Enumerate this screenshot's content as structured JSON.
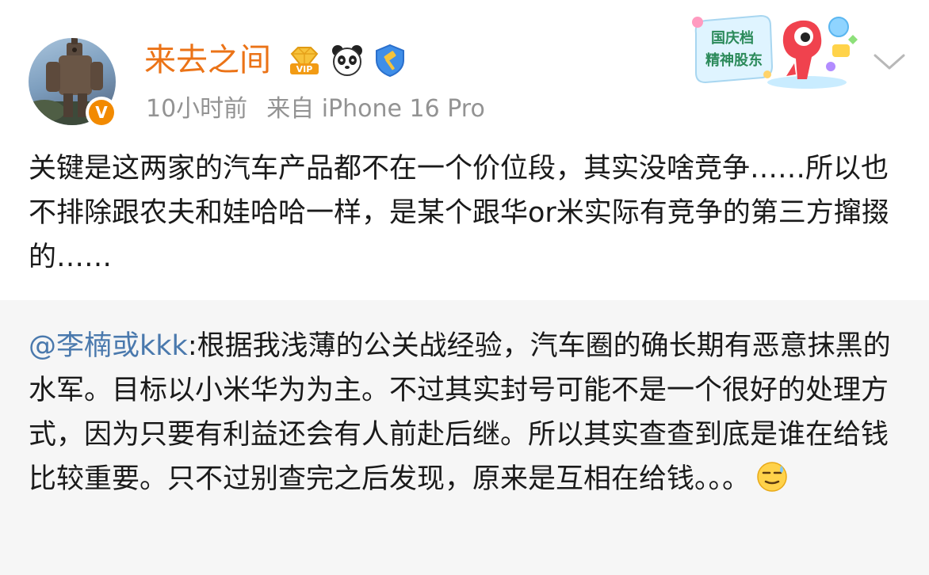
{
  "post": {
    "username": "来去之间",
    "time": "10小时前",
    "source": "来自 iPhone 16 Pro",
    "badges": [
      "vip-icon",
      "panda-icon",
      "hammer-shield-icon"
    ],
    "verified_badge": "V",
    "text": "关键是这两家的汽车产品都不在一个价位段，其实没啥竞争……所以也不排除跟农夫和娃哈哈一样，是某个跟华or米实际有竞争的第三方撺掇的……"
  },
  "promo": {
    "line1": "国庆档",
    "line2": "精神股东"
  },
  "repost": {
    "mention": "@李楠或kkk",
    "text": ":根据我浅薄的公关战经验，汽车圈的确长期有恶意抹黑的水军。目标以小米华为为主。不过其实封号可能不是一个很好的处理方式，因为只要有利益还会有人前赴后继。所以其实查查到底是谁在给钱比较重要。只不过别查完之后发现，原来是互相在给钱。。。",
    "emoji": "sweat-smile-emoji"
  },
  "colors": {
    "username": "#eb7317",
    "mention": "#4a79ad",
    "meta": "#939393",
    "repost_bg": "#f6f6f6"
  }
}
